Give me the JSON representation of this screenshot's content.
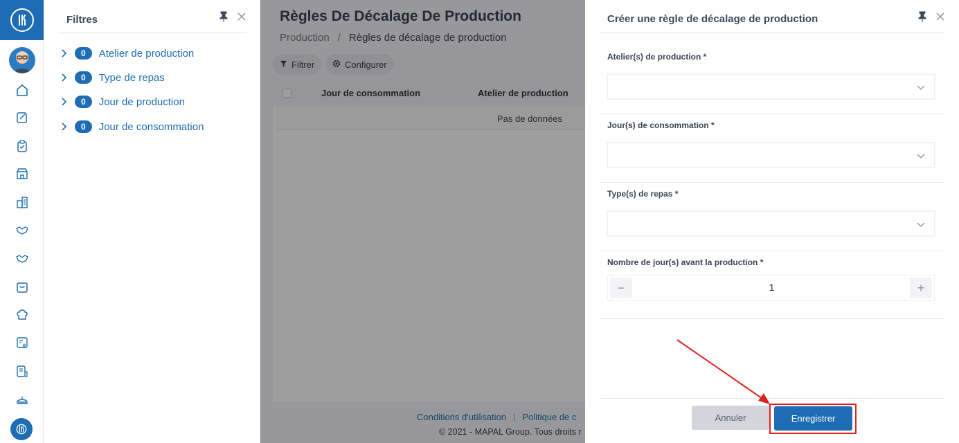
{
  "filters": {
    "title": "Filtres",
    "items": [
      {
        "count": "0",
        "label": "Atelier de production"
      },
      {
        "count": "0",
        "label": "Type de repas"
      },
      {
        "count": "0",
        "label": "Jour de production"
      },
      {
        "count": "0",
        "label": "Jour de consommation"
      }
    ]
  },
  "page": {
    "title": "Règles De Décalage De Production",
    "breadcrumb": {
      "parent": "Production",
      "separator": "/",
      "current": "Règles de décalage de production"
    },
    "toolbar": {
      "filter_label": "Filtrer",
      "configure_label": "Configurer"
    },
    "table": {
      "columns": [
        "Jour de consommation",
        "Atelier de production"
      ],
      "empty_text": "Pas de données"
    },
    "footer": {
      "terms": "Conditions d'utilisation",
      "separator": "|",
      "privacy": "Politique de c",
      "copyright": "© 2021 - MAPAL Group. Tous droits r"
    }
  },
  "drawer": {
    "title": "Créer une règle de décalage de production",
    "fields": {
      "atelier_label": "Atelier(s) de production *",
      "consommation_label": "Jour(s) de consommation *",
      "repas_label": "Type(s) de repas *",
      "nombre_label": "Nombre de jour(s) avant la production *",
      "nombre_value": "1",
      "minus": "−",
      "plus": "+"
    },
    "buttons": {
      "cancel": "Annuler",
      "save": "Enregistrer"
    }
  },
  "colors": {
    "brand": "#1e6db4",
    "highlight": "#e0201f"
  },
  "icons": [
    "app-logo-icon",
    "avatar",
    "home-icon",
    "edit-icon",
    "clipboard-icon",
    "store-icon",
    "building-icon",
    "handshake-icon",
    "bag-icon",
    "chef-hat-icon",
    "menu-card-icon",
    "document-icon",
    "cloche-icon",
    "pin-icon",
    "close-icon",
    "chevron-right-icon",
    "chevron-down-icon",
    "funnel-icon",
    "gear-icon"
  ]
}
